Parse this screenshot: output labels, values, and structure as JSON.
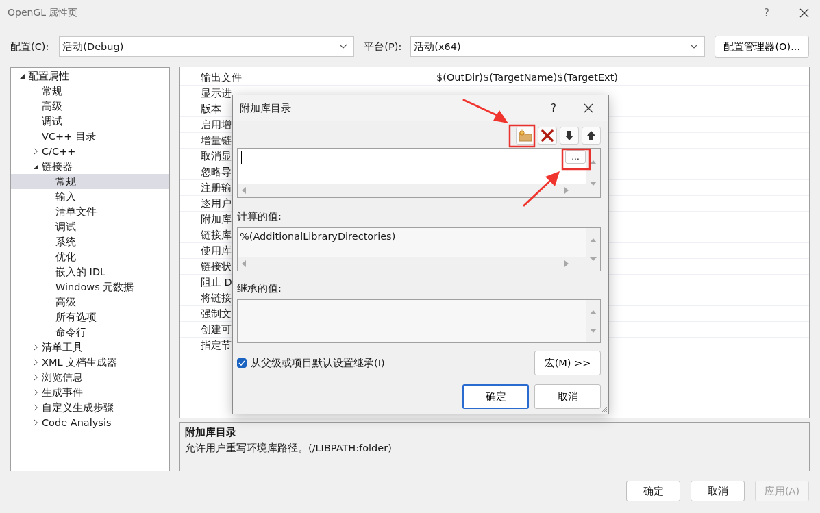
{
  "window": {
    "title": "OpenGL 属性页",
    "help": "?"
  },
  "configuration": {
    "label": "配置(C):",
    "value": "活动(Debug)"
  },
  "platform": {
    "label": "平台(P):",
    "value": "活动(x64)"
  },
  "configuration_manager_button": "配置管理器(O)...",
  "tree": [
    {
      "label": "配置属性",
      "expanded": true,
      "selected": false,
      "children": [
        {
          "label": "常规",
          "selected": false
        },
        {
          "label": "高级",
          "selected": false
        },
        {
          "label": "调试",
          "selected": false
        },
        {
          "label": "VC++ 目录",
          "selected": false
        },
        {
          "label": "C/C++",
          "expanded": false,
          "selected": false
        },
        {
          "label": "链接器",
          "expanded": true,
          "selected": false,
          "children": [
            {
              "label": "常规",
              "selected": true
            },
            {
              "label": "输入",
              "selected": false
            },
            {
              "label": "清单文件",
              "selected": false
            },
            {
              "label": "调试",
              "selected": false
            },
            {
              "label": "系统",
              "selected": false
            },
            {
              "label": "优化",
              "selected": false
            },
            {
              "label": "嵌入的 IDL",
              "selected": false
            },
            {
              "label": "Windows 元数据",
              "selected": false
            },
            {
              "label": "高级",
              "selected": false
            },
            {
              "label": "所有选项",
              "selected": false
            },
            {
              "label": "命令行",
              "selected": false
            }
          ]
        },
        {
          "label": "清单工具",
          "expanded": false,
          "selected": false
        },
        {
          "label": "XML 文档生成器",
          "expanded": false,
          "selected": false
        },
        {
          "label": "浏览信息",
          "expanded": false,
          "selected": false
        },
        {
          "label": "生成事件",
          "expanded": false,
          "selected": false
        },
        {
          "label": "自定义生成步骤",
          "expanded": false,
          "selected": false
        },
        {
          "label": "Code Analysis",
          "expanded": false,
          "selected": false
        }
      ]
    }
  ],
  "properties": [
    {
      "name": "输出文件",
      "value": "$(OutDir)$(TargetName)$(TargetExt)"
    },
    {
      "name": "显示进"
    },
    {
      "name": "版本"
    },
    {
      "name": "启用增"
    },
    {
      "name": "增量链"
    },
    {
      "name": "取消显"
    },
    {
      "name": "忽略导"
    },
    {
      "name": "注册输"
    },
    {
      "name": "逐用户"
    },
    {
      "name": "附加库"
    },
    {
      "name": "链接库"
    },
    {
      "name": "使用库"
    },
    {
      "name": "链接状"
    },
    {
      "name": "阻止 D"
    },
    {
      "name": "将链接"
    },
    {
      "name": "强制文"
    },
    {
      "name": "创建可"
    },
    {
      "name": "指定节"
    }
  ],
  "description": {
    "title": "附加库目录",
    "text": "允许用户重写环境库路径。(/LIBPATH:folder)"
  },
  "buttons": [
    {
      "label": "确定",
      "disabled": false
    },
    {
      "label": "取消",
      "disabled": false
    },
    {
      "label": "应用(A)",
      "disabled": true
    }
  ],
  "dialog": {
    "title": "附加库目录",
    "help": "?",
    "edit_button": "...",
    "computed_label": "计算的值:",
    "computed_value": "%(AdditionalLibraryDirectories)",
    "inherited_label": "继承的值:",
    "inherit_checkbox": {
      "label": "从父级或项目默认设置继承(I)",
      "checked": true
    },
    "macros_button": "宏(M) >>",
    "buttons": [
      {
        "label": "确定",
        "default": true
      },
      {
        "label": "取消",
        "default": false
      }
    ]
  }
}
